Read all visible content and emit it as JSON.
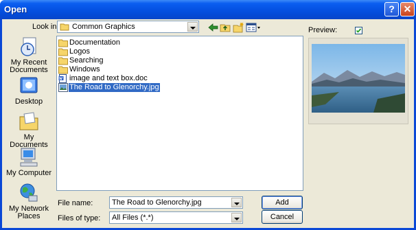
{
  "window": {
    "title": "Open"
  },
  "titlebar_buttons": {
    "help": "?",
    "close": "✕"
  },
  "lookin": {
    "label": "Look in:",
    "value": "Common Graphics"
  },
  "places": [
    {
      "label": "My Recent Documents"
    },
    {
      "label": "Desktop"
    },
    {
      "label": "My Documents"
    },
    {
      "label": "My Computer"
    },
    {
      "label": "My Network Places"
    }
  ],
  "files": [
    {
      "name": "Documentation",
      "type": "folder"
    },
    {
      "name": "Logos",
      "type": "folder"
    },
    {
      "name": "Searching",
      "type": "folder"
    },
    {
      "name": "Windows",
      "type": "folder"
    },
    {
      "name": "image and text box.doc",
      "type": "doc"
    },
    {
      "name": "The Road to Glenorchy.jpg",
      "type": "image",
      "selected": true
    }
  ],
  "preview": {
    "label": "Preview:",
    "checked": true
  },
  "filename": {
    "label": "File name:",
    "value": "The Road to Glenorchy.jpg"
  },
  "filetype": {
    "label": "Files of type:",
    "value": "All Files (*.*)"
  },
  "buttons": {
    "add": "Add",
    "cancel": "Cancel"
  },
  "colors": {
    "titlebar": "#0552e3",
    "dialog_bg": "#ece9d8",
    "selection": "#316ac5"
  }
}
